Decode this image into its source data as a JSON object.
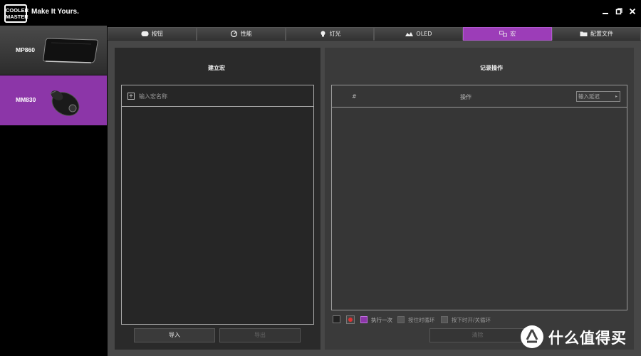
{
  "titlebar": {
    "logo_line1": "COOLER",
    "logo_line2": "MASTER",
    "tagline": "Make It Yours.",
    "controls": {
      "minimize": "▬",
      "restore": "❐",
      "close": "✕"
    }
  },
  "sidebar": {
    "devices": [
      {
        "label": "MP860",
        "icon": "mousepad-icon"
      },
      {
        "label": "MM830",
        "icon": "mouse-icon",
        "selected": true
      }
    ]
  },
  "tabs": [
    {
      "label": "按钮",
      "icon": "mouse-button-icon"
    },
    {
      "label": "性能",
      "icon": "gauge-icon"
    },
    {
      "label": "灯光",
      "icon": "bulb-icon"
    },
    {
      "label": "OLED",
      "icon": "oled-icon"
    },
    {
      "label": "宏",
      "icon": "macro-icon",
      "active": true
    },
    {
      "label": "配置文件",
      "icon": "folder-icon"
    }
  ],
  "left_panel": {
    "title": "建立宏",
    "macro_name_placeholder": "输入宏名称",
    "add_symbol": "+",
    "import_label": "导入",
    "export_label": "导出"
  },
  "right_panel": {
    "title": "记录操作",
    "col_index": "#",
    "col_action": "操作",
    "delay_placeholder": "输入延迟",
    "options": [
      "执行一次",
      "按住时循环",
      "按下时开/关循环"
    ],
    "clear_label": "清除"
  },
  "colors": {
    "accent": "#8c36a8",
    "panel_dark": "#2a2a2a",
    "panel_right": "#3a3a3a"
  },
  "watermark": {
    "text": "什么值得买",
    "logo_glyph": "值"
  }
}
